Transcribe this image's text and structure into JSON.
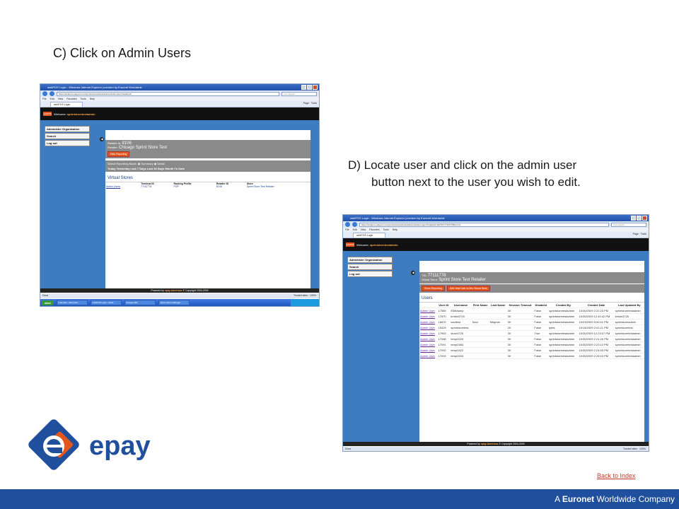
{
  "slide": {
    "step_c": "C) Click on Admin Users",
    "step_d_line1": "D) Locate user and click on the admin user",
    "step_d_line2": "button next to the user you wish to edit.",
    "back_link": "Back to Index",
    "company_prefix": "A ",
    "company_brand": "Euronet",
    "company_suffix": " Worldwide Company",
    "logo_text": "epay",
    "colors": {
      "brand_blue": "#1f4f9d",
      "brand_orange": "#e3571f",
      "link_red": "#c0392b"
    }
  },
  "browser": {
    "window_title": "webPOS Login - Windows Internet Explorer provided by Euronet Worldwide",
    "url1": "https://webpos.epaypol.com/sprintstores/administration/index.aspx?retailerId=",
    "url2": "https://webpos.epaypol.com/sprintstores/administration/retailers.aspx?retailerId=&&TID=77111778&s=nrlc",
    "search_placeholder": "Live Search",
    "menu": [
      "File",
      "Edit",
      "View",
      "Favorites",
      "Tools",
      "Help"
    ],
    "tab": "webPOS Login",
    "tools": "Page  ·  Tools",
    "status_done": "Done",
    "status_trusted": "Trusted sites",
    "status_zoom": "100%"
  },
  "app": {
    "logo": "webPOS",
    "welcome_prefix": "Welcome: ",
    "welcome_user": "sprintstoretestadmin",
    "side_menu": [
      "Administer Organization",
      "Search",
      "Log out"
    ],
    "footer_prefix": "Powered by ",
    "footer_brand": "epay Americas",
    "footer_copy": "© Copyright 2004-2009"
  },
  "shot1": {
    "retailer_id_label": "Retailer Id:",
    "retailer_id": "8106",
    "retailer_label": "Retailer:",
    "retailer_name": "Chicago Sprint Store Test",
    "hide_reporting": "Hide Reporting",
    "report_mode": "Select Reporting Mode:  ◉ Summary  ◉ Detail",
    "report_links": "Today  Yesterday  Last 7 Days  Last 30 Days  Month To Date",
    "section": "Virtual Stores",
    "columns": [
      "",
      "Terminal ID",
      "Routing Profile",
      "Retailer ID",
      "Store"
    ],
    "row": [
      "Admin Users",
      "77111778",
      "POP",
      "8106",
      "Sprint Store Test Retailer"
    ]
  },
  "shot2": {
    "tid_label": "TID:",
    "tid": "77111778",
    "vstore_label": "Virtual Store:",
    "vstore_name": "Sprint Store Test Retailer",
    "btn_show": "Show Reporting",
    "btn_add": "Add New User to this Virtual Store",
    "section": "Users",
    "columns": [
      "",
      "User ID",
      "Username",
      "First Name",
      "Last Name",
      "Session Timeout",
      "Disabled",
      "Created By",
      "Created Date",
      "Last Updated By"
    ],
    "rows": [
      [
        "Admin User",
        "17589",
        "E58thamp",
        "",
        "",
        "30",
        "False",
        "sprintstoretestadmin",
        "10/30/2009 2:22:23 PM",
        "sprintstoretestadmin"
      ],
      [
        "Admin User",
        "17870",
        "kristin3725",
        "",
        "",
        "30",
        "False",
        "sprintstoretestadmin",
        "10/30/2009 12:40:42 PM",
        "kristin3725"
      ],
      [
        "Admin User",
        "16870",
        "saultest",
        "Saul",
        "Milgram",
        "30",
        "False",
        "sprintstoretestadmin",
        "10/29/2009 5:00:41 PM",
        "sprintstoreadmin"
      ],
      [
        "Admin User",
        "15429",
        "sprintstoretest",
        "",
        "",
        "20",
        "False",
        "tpitts",
        "10/16/2009 2:41:21 PM",
        "sprintstoretest"
      ],
      [
        "Admin User",
        "17963",
        "store3725",
        "",
        "",
        "30",
        "True",
        "sprintstoretestadmin",
        "10/30/2009 12:23:07 PM",
        "sprintstoretestadmin"
      ],
      [
        "Admin User",
        "17088",
        "temp0220",
        "",
        "",
        "30",
        "False",
        "sprintstoretestadmin",
        "10/30/2009 2:21:26 PM",
        "sprintstoretestadmin"
      ],
      [
        "Admin User",
        "17091",
        "temp0384",
        "",
        "",
        "30",
        "False",
        "sprintstoretestadmin",
        "10/30/2009 2:23:10 PM",
        "sprintstoretestadmin"
      ],
      [
        "Admin User",
        "17092",
        "temp0422",
        "",
        "",
        "30",
        "False",
        "sprintstoretestadmin",
        "10/30/2009 2:24:05 PM",
        "sprintstoretestadmin"
      ],
      [
        "Admin User",
        "17093",
        "temp0533",
        "",
        "",
        "30",
        "False",
        "sprintstoretestadmin",
        "10/30/2009 2:25:03 PM",
        "sprintstoretestadmin"
      ]
    ]
  },
  "taskbar": {
    "start": "start",
    "tasks": [
      "Calendar - Microsoft ...",
      "webPOS Login - Wind...",
      "Google Talk",
      "Sprint Store Manager..."
    ]
  }
}
